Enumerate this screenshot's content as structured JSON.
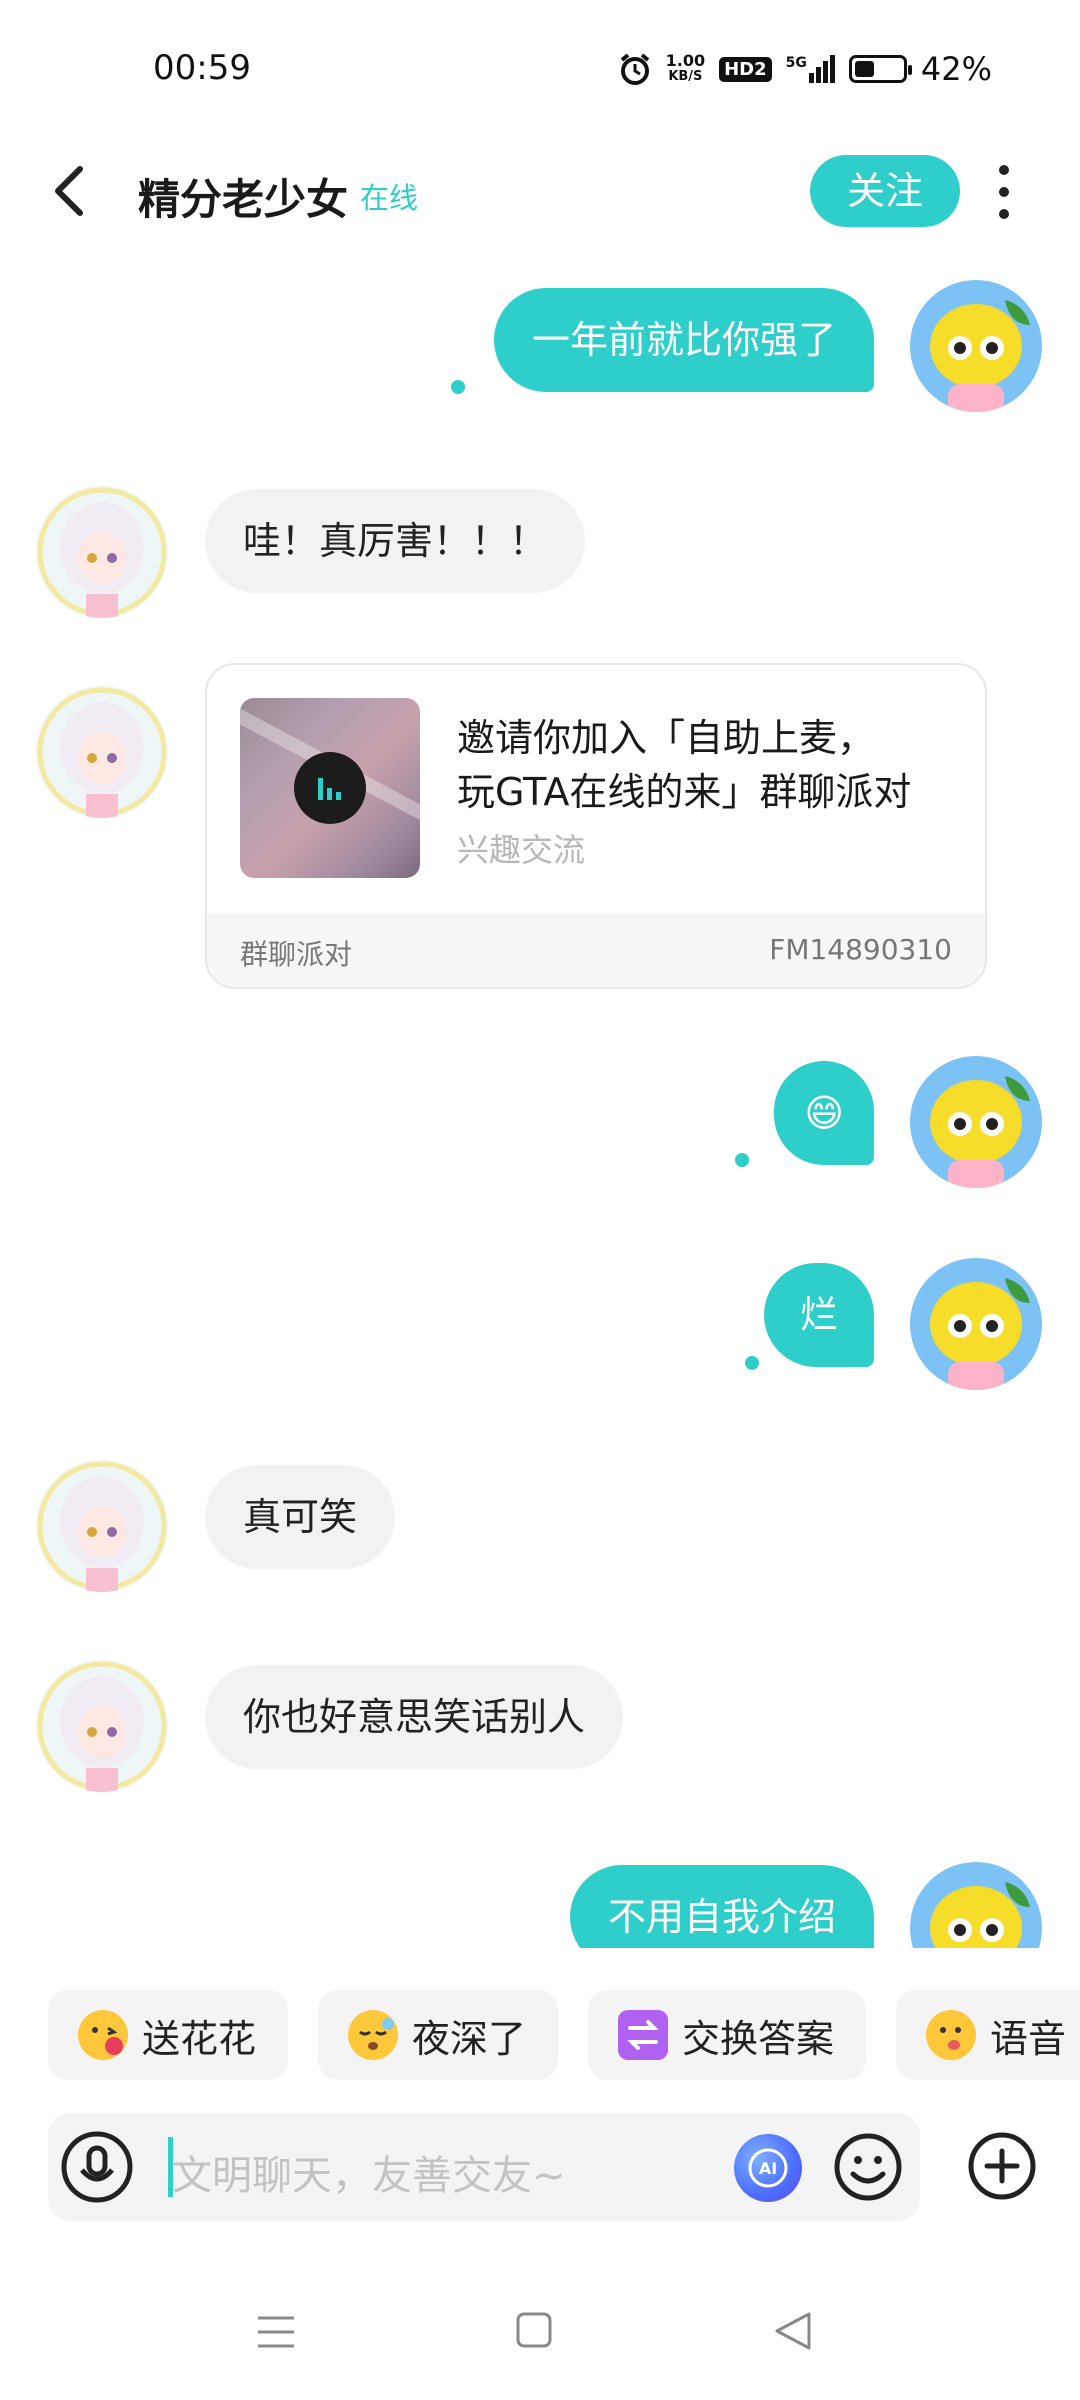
{
  "status_bar": {
    "time": "00:59",
    "net_speed_value": "1.00",
    "net_speed_unit": "KB/S",
    "hd_label": "HD2",
    "signal_label": "5G",
    "battery_percent": "42%",
    "battery_level": 0.42
  },
  "header": {
    "title": "精分老少女",
    "online_status": "在线",
    "follow_label": "关注"
  },
  "messages": [
    {
      "side": "out",
      "text": "一年前就比你强了"
    },
    {
      "side": "in",
      "text": "哇！真厉害！！！"
    },
    {
      "side": "in",
      "type": "card"
    },
    {
      "side": "out",
      "text": "😄"
    },
    {
      "side": "out",
      "text": "烂"
    },
    {
      "side": "in",
      "text": "真可笑"
    },
    {
      "side": "in",
      "text": "你也好意思笑话别人"
    },
    {
      "side": "out",
      "text": "不用自我介绍"
    }
  ],
  "card": {
    "title_line1": "邀请你加入「自助上麦，",
    "title_line2": "玩GTA在线的来」群聊派对",
    "subtitle": "兴趣交流",
    "footer_left": "群聊派对",
    "footer_right": "FM14890310"
  },
  "quick_chips": [
    {
      "label": "送花花",
      "icon": "flower-kiss-emoji-icon"
    },
    {
      "label": "夜深了",
      "icon": "sleepy-emoji-icon"
    },
    {
      "label": "交换答案",
      "icon": "exchange-icon"
    },
    {
      "label": "语音",
      "icon": "tongue-emoji-icon"
    }
  ],
  "input": {
    "placeholder": "文明聊天，友善交友~",
    "ai_label": "AI"
  },
  "colors": {
    "accent": "#2ecfcb",
    "bubble_in": "#f2f2f2",
    "chip_bg": "#f4f4f4"
  }
}
